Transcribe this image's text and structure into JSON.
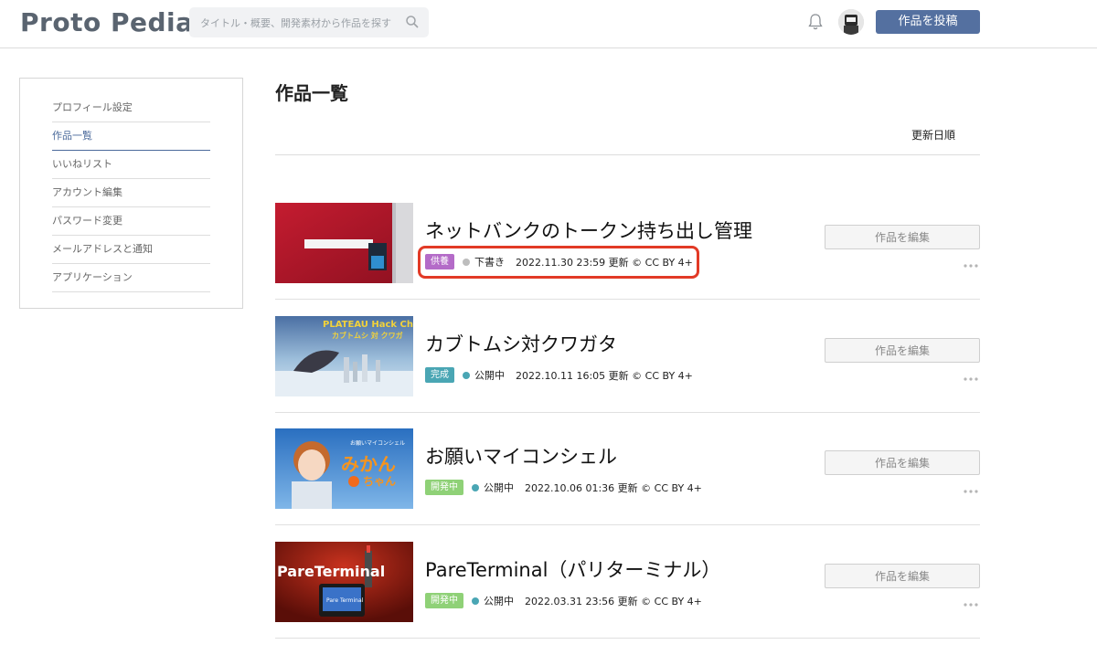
{
  "header": {
    "logo_part1": "Proto ",
    "logo_part2": "Pedia",
    "search_placeholder": "タイトル・概要、開発素材から作品を探す",
    "post_button": "作品を投稿"
  },
  "sidebar": {
    "items": [
      {
        "label": "プロフィール設定"
      },
      {
        "label": "作品一覧"
      },
      {
        "label": "いいねリスト"
      },
      {
        "label": "アカウント編集"
      },
      {
        "label": "パスワード変更"
      },
      {
        "label": "メールアドレスと通知"
      },
      {
        "label": "アプリケーション"
      }
    ],
    "active_index": 1
  },
  "main": {
    "title": "作品一覧",
    "sort_label": "更新日順",
    "edit_label": "作品を編集",
    "projects": [
      {
        "title": "ネットバンクのトークン持ち出し管理",
        "badge": "供養",
        "badge_color": "#b46bc8",
        "status": "下書き",
        "status_color": "#bdbdbd",
        "updated": "2022.11.30 23:59 更新 © CC BY 4+"
      },
      {
        "title": "カブトムシ対クワガタ",
        "badge": "完成",
        "badge_color": "#4aa6b4",
        "status": "公開中",
        "status_color": "#4aa6b4",
        "updated": "2022.10.11 16:05 更新 © CC BY 4+"
      },
      {
        "title": "お願いマイコンシェル",
        "badge": "開発中",
        "badge_color": "#8fd177",
        "status": "公開中",
        "status_color": "#4aa6b4",
        "updated": "2022.10.06 01:36 更新 © CC BY 4+"
      },
      {
        "title": "PareTerminal（パリターミナル）",
        "badge": "開発中",
        "badge_color": "#8fd177",
        "status": "公開中",
        "status_color": "#4aa6b4",
        "updated": "2022.03.31 23:56 更新 © CC BY 4+"
      }
    ]
  },
  "thumbs": {
    "t2_text": "PLATEAU Hack Challe",
    "t2_sub": "カブトムシ 対 クワガ",
    "t3_text": "みかん",
    "t3_sub": "ちゃん",
    "t3_top": "お願いマイコンシェル",
    "t4_text": "PareTerminal",
    "t4_screen": "Pare Terminal"
  }
}
